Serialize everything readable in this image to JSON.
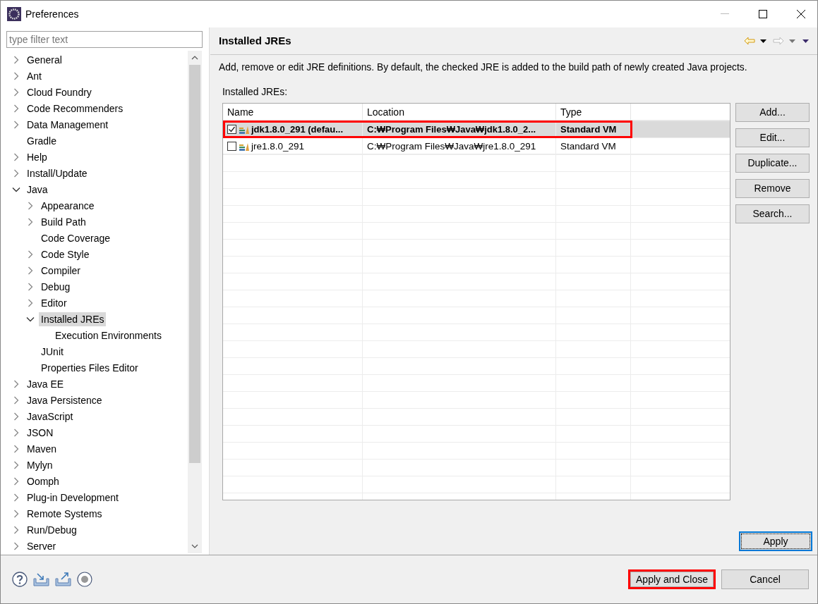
{
  "window": {
    "title": "Preferences"
  },
  "filter": {
    "placeholder": "type filter text"
  },
  "tree": [
    {
      "label": "General",
      "expanded": false,
      "selected": false
    },
    {
      "label": "Ant",
      "expanded": false,
      "selected": false
    },
    {
      "label": "Cloud Foundry",
      "expanded": false,
      "selected": false
    },
    {
      "label": "Code Recommenders",
      "expanded": false,
      "selected": false
    },
    {
      "label": "Data Management",
      "expanded": false,
      "selected": false
    },
    {
      "label": "Gradle",
      "selected": false
    },
    {
      "label": "Help",
      "expanded": false,
      "selected": false
    },
    {
      "label": "Install/Update",
      "expanded": false,
      "selected": false
    },
    {
      "label": "Java",
      "expanded": true,
      "selected": false,
      "children": [
        {
          "label": "Appearance",
          "expanded": false,
          "selected": false
        },
        {
          "label": "Build Path",
          "expanded": false,
          "selected": false
        },
        {
          "label": "Code Coverage",
          "selected": false
        },
        {
          "label": "Code Style",
          "expanded": false,
          "selected": false
        },
        {
          "label": "Compiler",
          "expanded": false,
          "selected": false
        },
        {
          "label": "Debug",
          "expanded": false,
          "selected": false
        },
        {
          "label": "Editor",
          "expanded": false,
          "selected": false
        },
        {
          "label": "Installed JREs",
          "expanded": true,
          "selected": true,
          "children": [
            {
              "label": "Execution Environments",
              "selected": false
            }
          ]
        },
        {
          "label": "JUnit",
          "selected": false
        },
        {
          "label": "Properties Files Editor",
          "selected": false
        }
      ]
    },
    {
      "label": "Java EE",
      "expanded": false,
      "selected": false
    },
    {
      "label": "Java Persistence",
      "expanded": false,
      "selected": false
    },
    {
      "label": "JavaScript",
      "expanded": false,
      "selected": false
    },
    {
      "label": "JSON",
      "expanded": false,
      "selected": false
    },
    {
      "label": "Maven",
      "expanded": false,
      "selected": false
    },
    {
      "label": "Mylyn",
      "expanded": false,
      "selected": false
    },
    {
      "label": "Oomph",
      "expanded": false,
      "selected": false
    },
    {
      "label": "Plug-in Development",
      "expanded": false,
      "selected": false
    },
    {
      "label": "Remote Systems",
      "expanded": false,
      "selected": false
    },
    {
      "label": "Run/Debug",
      "expanded": false,
      "selected": false
    },
    {
      "label": "Server",
      "expanded": false,
      "selected": false
    }
  ],
  "page": {
    "title": "Installed JREs",
    "description": "Add, remove or edit JRE definitions. By default, the checked JRE is added to the build path of newly created Java projects.",
    "table_label": "Installed JREs:"
  },
  "table": {
    "columns": [
      "Name",
      "Location",
      "Type"
    ],
    "rows": [
      {
        "name": "jdk1.8.0_291 (defau...",
        "location": "C:₩Program Files₩Java₩jdk1.8.0_2...",
        "type": "Standard VM",
        "checked": true,
        "selected": true,
        "highlighted": true
      },
      {
        "name": "jre1.8.0_291",
        "location": "C:₩Program Files₩Java₩jre1.8.0_291",
        "type": "Standard VM",
        "checked": false,
        "selected": false,
        "highlighted": false
      }
    ]
  },
  "side_buttons": [
    "Add...",
    "Edit...",
    "Duplicate...",
    "Remove",
    "Search..."
  ],
  "apply_button": {
    "label": "Apply",
    "focused": true
  },
  "footer_buttons": [
    {
      "label": "Apply and Close",
      "highlighted": true
    },
    {
      "label": "Cancel",
      "highlighted": false
    }
  ]
}
